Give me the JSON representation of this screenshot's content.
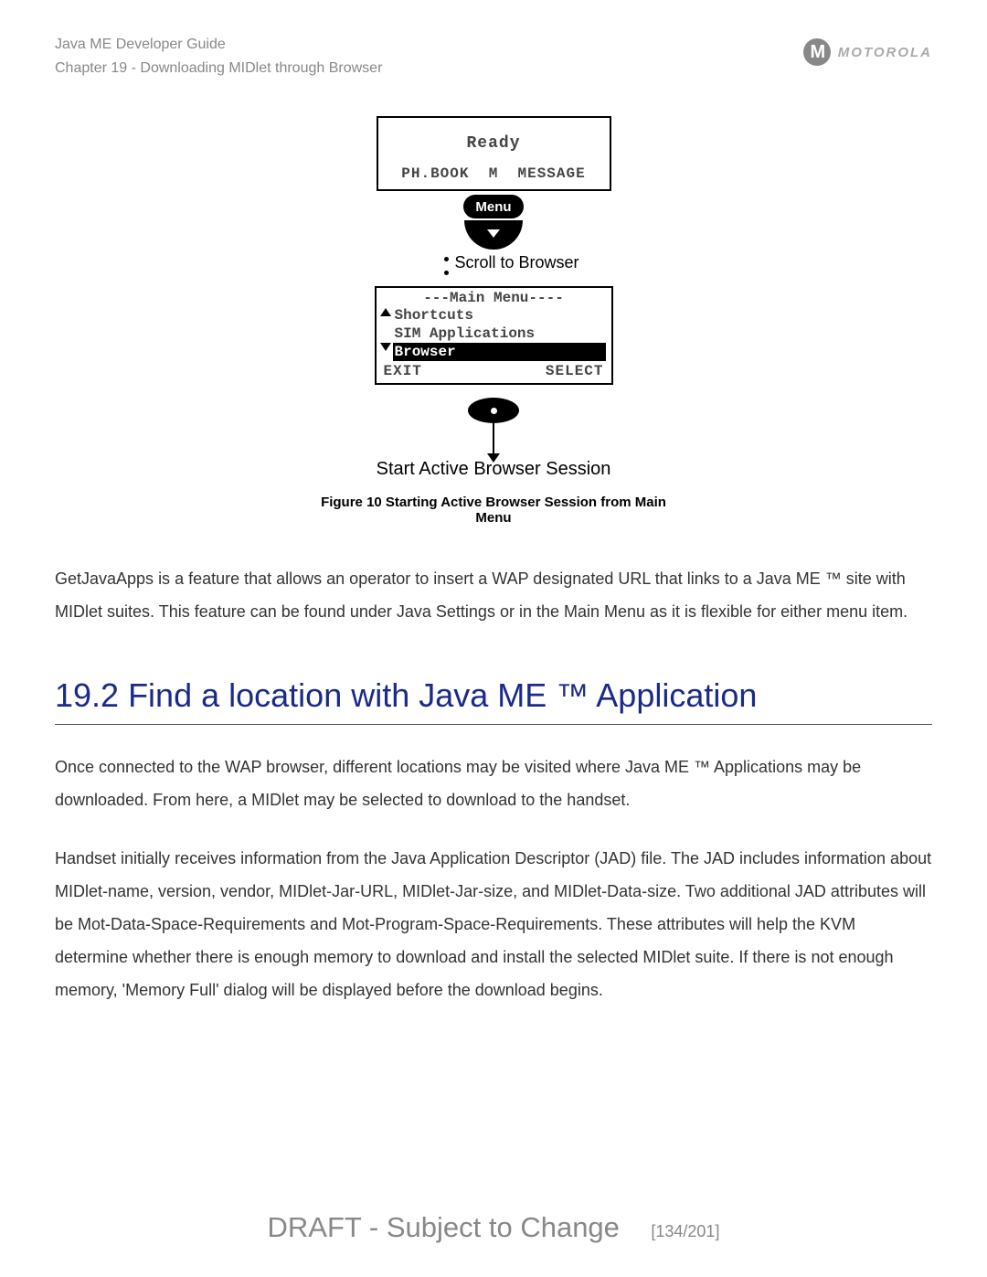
{
  "header": {
    "guide_title": "Java ME Developer Guide",
    "chapter_line": "Chapter 19 - Downloading MIDlet through Browser",
    "brand": "MOTOROLA"
  },
  "figure": {
    "screen1": {
      "ready": "Ready",
      "left_soft": "PH.BOOK",
      "center": "M",
      "right_soft": "MESSAGE",
      "menu_label": "Menu"
    },
    "scroll_label": "Scroll to Browser",
    "screen2": {
      "title": "---Main Menu----",
      "item1": "Shortcuts",
      "item2": "SIM Applications",
      "selected": "Browser",
      "exit": "EXIT",
      "select": "SELECT"
    },
    "session_label": "Start Active Browser Session",
    "caption": "Figure 10 Starting Active Browser Session from Main Menu"
  },
  "para1": "GetJavaApps is a feature that allows an operator to insert a WAP designated URL that links to a Java ME ™ site with MIDlet suites. This feature can be found under Java Settings or in the Main Menu as it is flexible for either menu item.",
  "section_heading": "19.2 Find a location with Java ME ™ Application",
  "para2": "Once connected to the WAP browser, different locations may be visited where Java ME ™ Applications may be downloaded. From here, a MIDlet may be selected to download to the handset.",
  "para3": "Handset initially receives information from the Java Application Descriptor (JAD) file. The JAD includes information about MIDlet-name, version, vendor, MIDlet-Jar-URL, MIDlet-Jar-size, and MIDlet-Data-size. Two additional JAD attributes will be Mot-Data-Space-Requirements and Mot-Program-Space-Requirements. These attributes will help the KVM determine whether there is enough memory to download and install the selected MIDlet suite. If there is not enough memory, 'Memory Full' dialog will be displayed before the download begins.",
  "footer": {
    "draft": "DRAFT - Subject to Change",
    "page": "[134/201]"
  }
}
